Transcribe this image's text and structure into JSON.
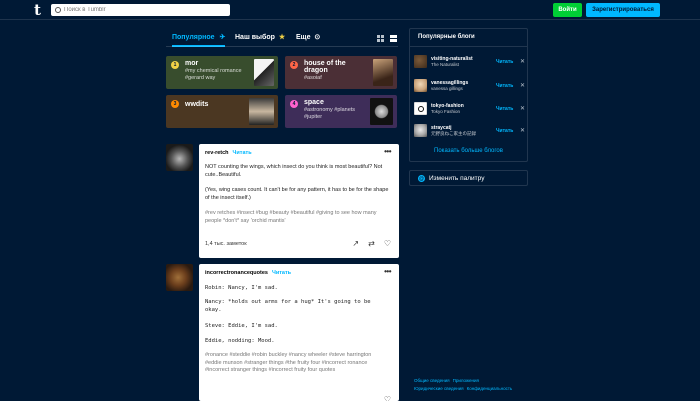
{
  "header": {
    "logo": "t",
    "search_placeholder": "Поиск в Tumblr",
    "login_label": "Войти",
    "register_label": "Зарегистрироваться",
    "colors": {
      "bg": "#001935",
      "login": "#00cf35",
      "register": "#00b8ff"
    }
  },
  "tabs": {
    "items": [
      {
        "label": "Популярное",
        "icon": "rocket-icon",
        "active": true
      },
      {
        "label": "Наш выбор",
        "icon": "star-icon",
        "active": false
      },
      {
        "label": "Еще",
        "icon": "chevron-down-circle-icon",
        "active": false
      }
    ]
  },
  "trending": [
    {
      "num": "1",
      "title": "mor",
      "tags": "#my chemical romance #gerard way",
      "color": "#384d2d",
      "accent": "#f0d146"
    },
    {
      "num": "2",
      "title": "house of the dragon",
      "tags": "#asoiaf",
      "color": "#4b2f36",
      "accent": "#ff6547"
    },
    {
      "num": "3",
      "title": "wwdits",
      "tags": "",
      "color": "#4b3722",
      "accent": "#ff8a00"
    },
    {
      "num": "4",
      "title": "space",
      "tags": "#astronomy #planets #jupiter",
      "color": "#3e2d59",
      "accent": "#ff62ce"
    }
  ],
  "posts": [
    {
      "username": "rev-retch",
      "follow": "Читать",
      "lines": [
        "NOT counting the wings, which insect do you think is most beautiful? Not cute..Beautiful.",
        "(Yes, wing cases count. It can't be for any pattern, it has to be for the shape of the insect itself.)"
      ],
      "tags": "#rev retches  #insect  #bug  #beauty  #beautiful  #giving to see how many people *don't* say 'orchid mantis'",
      "notes": "1,4 тыс. заметок"
    },
    {
      "username": "incorrectronancequotes",
      "follow": "Читать",
      "dialog": [
        "Robin: Nancy, I'm sad.",
        "Nancy: *holds out arms for a hug* It's going to be okay.",
        "Steve: Eddie, I'm sad.",
        "Eddie, nodding: Mood."
      ],
      "tags": "#ronance  #steddie  #robin buckley  #nancy wheeler  #steve harrington  #eddie munson  #stranger things  #the fruity four  #incorrect ronance  #incorrect stranger things  #incorrect fruity four quotes"
    }
  ],
  "sidebar": {
    "title": "Популярные блоги",
    "blogs": [
      {
        "name": "visiting-naturalist",
        "sub": "The Naturalist",
        "follow": "Читать"
      },
      {
        "name": "vanessagillings",
        "sub": "vanessa gillings",
        "follow": "Читать"
      },
      {
        "name": "tokyo-fashion",
        "sub": "Tokyo Fashion",
        "follow": "Читать"
      },
      {
        "name": "straycatj",
        "sub": "元野良ねこ家主の記録",
        "follow": "Читать"
      }
    ],
    "show_more": "Показать больше блогов",
    "palette_label": "Изменить палитру"
  },
  "footer": {
    "links": [
      "Общие сведения",
      "Приложения",
      "Юридические сведения",
      "Конфиденциальность"
    ]
  }
}
